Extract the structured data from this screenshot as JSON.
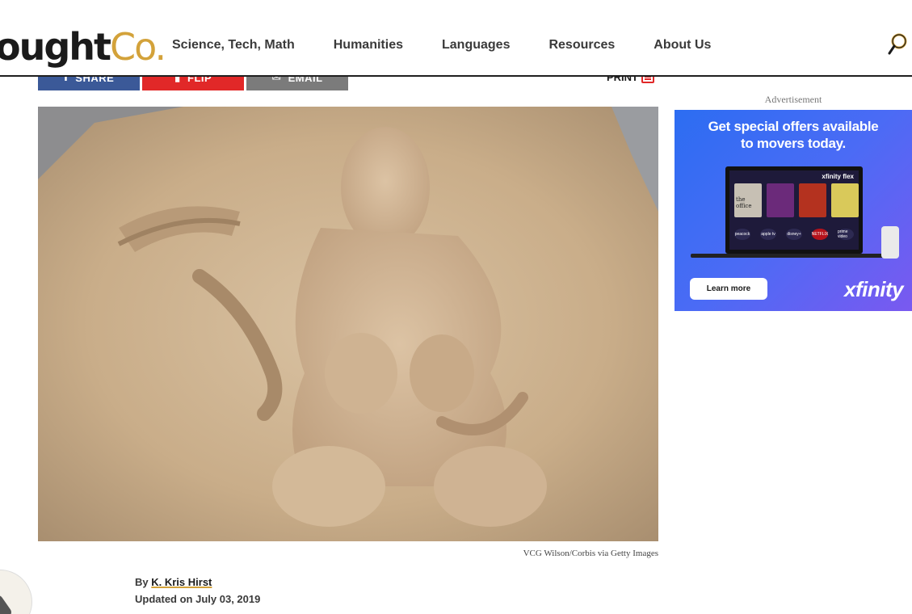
{
  "header": {
    "logo_main": "ought",
    "logo_co": "Co.",
    "nav": [
      "Science, Tech, Math",
      "Humanities",
      "Languages",
      "Resources",
      "About Us"
    ]
  },
  "share": {
    "facebook_label": "SHARE",
    "flipboard_label": "FLIP",
    "email_label": "EMAIL",
    "print_label": "PRINT"
  },
  "hero": {
    "caption": "VCG Wilson/Corbis via Getty Images"
  },
  "byline": {
    "prefix": "By",
    "author": "K. Kris Hirst",
    "updated": "Updated on July 03, 2019"
  },
  "ad": {
    "label": "Advertisement",
    "headline_line1": "Get special offers available",
    "headline_line2": "to movers today.",
    "tv_brand": "xfinity flex",
    "tv_show": "the office",
    "tv_apps": [
      "peacock",
      "apple tv",
      "disney+",
      "NETFLIX",
      "prime video"
    ],
    "cta": "Learn more",
    "brand": "xfinity"
  },
  "colors": {
    "accent_gold": "#d3a23a",
    "facebook_blue": "#3b5998",
    "flipboard_red": "#e12828",
    "email_gray": "#7b7b7b",
    "ad_blue": "#2c6df2"
  }
}
